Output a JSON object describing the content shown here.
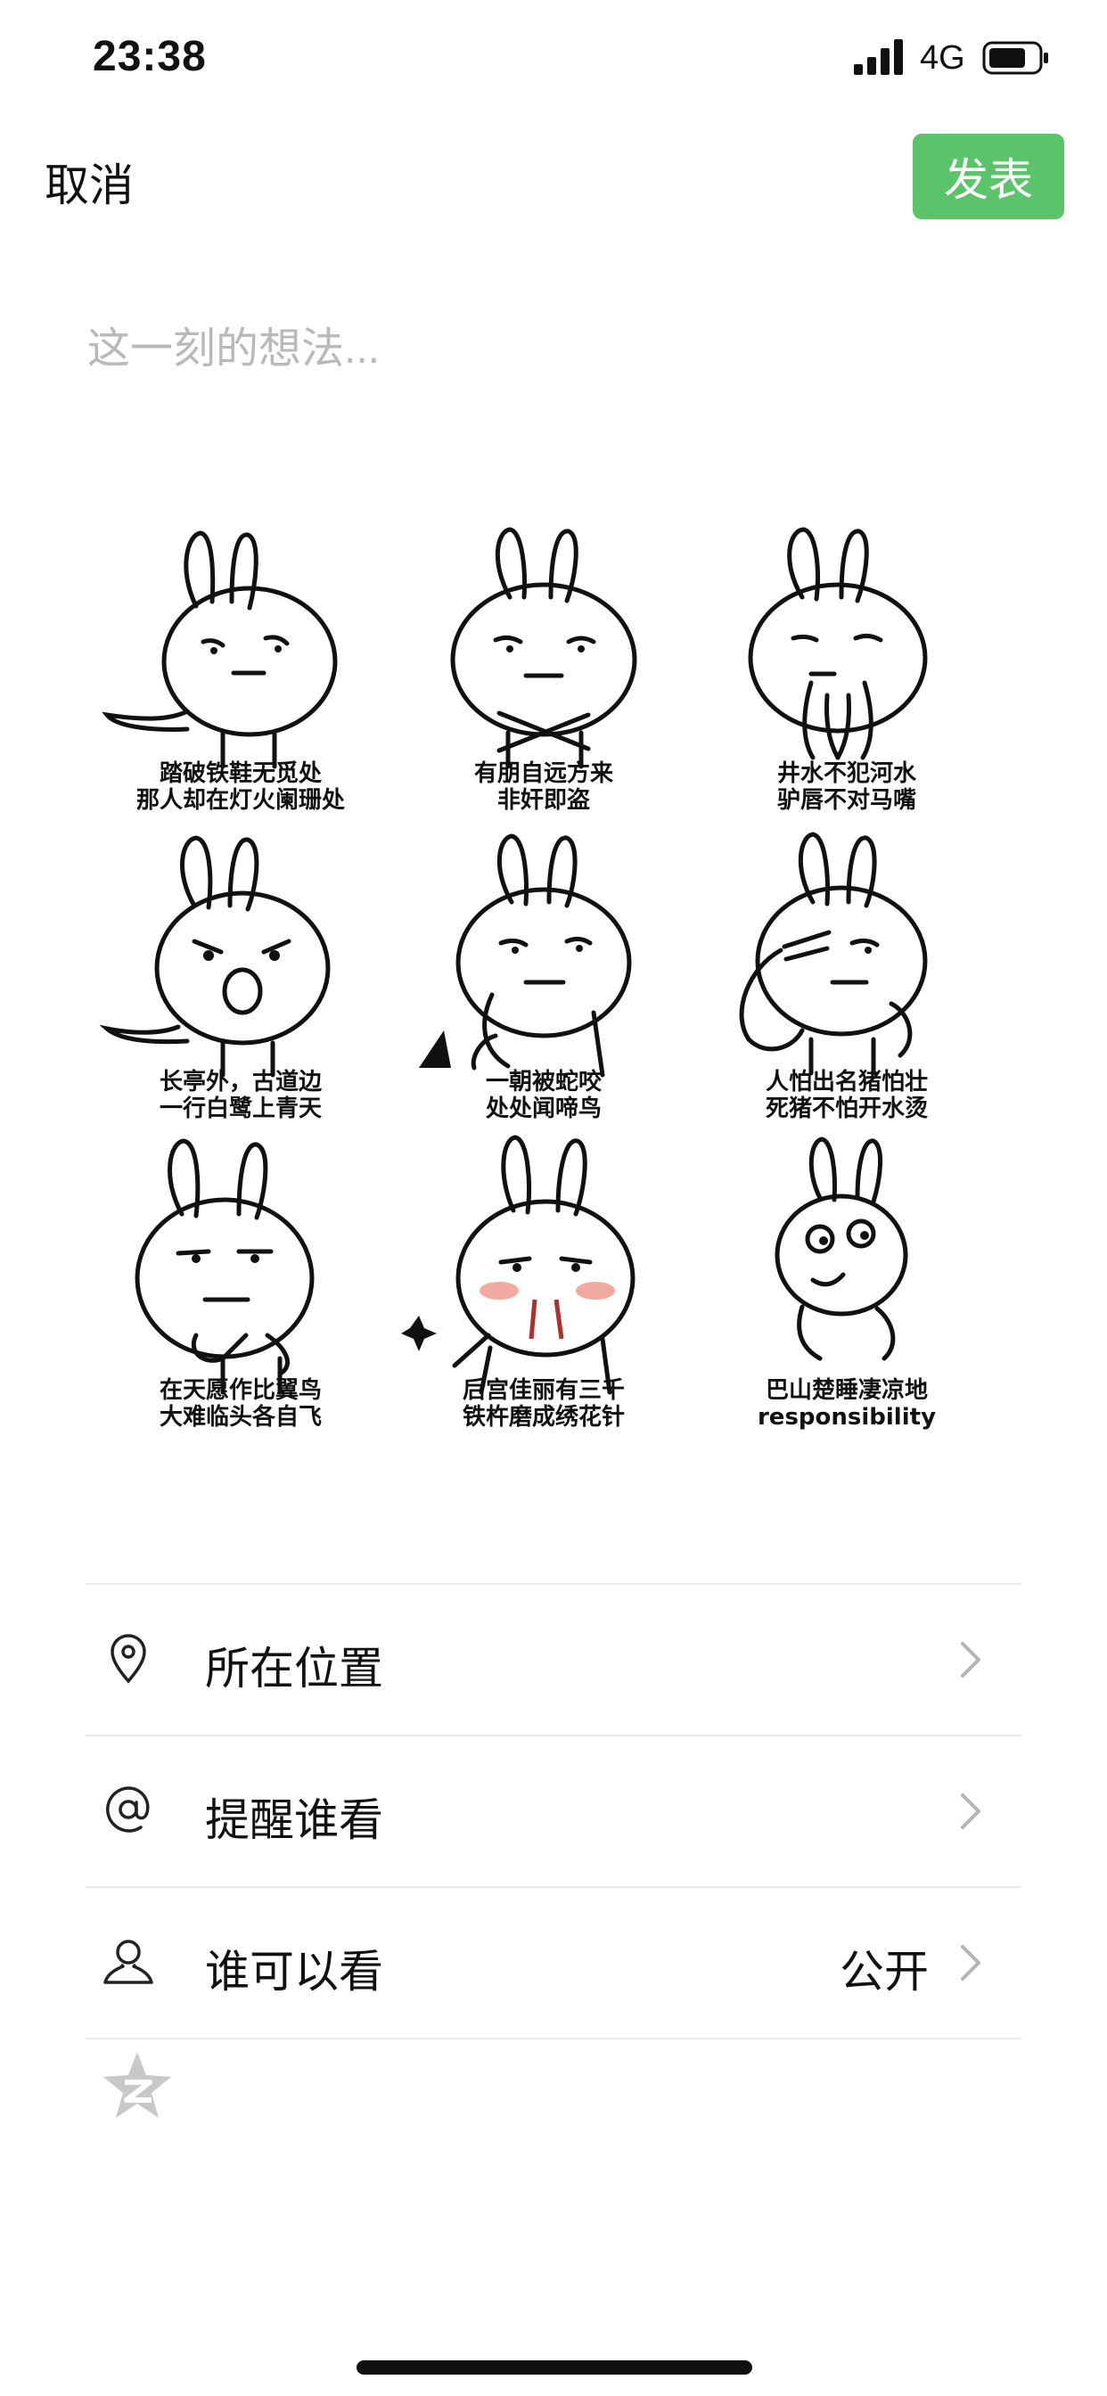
{
  "status_bar": {
    "time": "23:38",
    "network": "4G",
    "icons": [
      "signal-icon",
      "battery-icon"
    ]
  },
  "nav": {
    "cancel_label": "取消",
    "publish_label": "发表"
  },
  "compose": {
    "placeholder": "这一刻的想法..."
  },
  "images": [
    {
      "line1": "踏破铁鞋无觅处",
      "line2": "那人却在灯火阑珊处"
    },
    {
      "line1": "有朋自远方来",
      "line2": "非奸即盗"
    },
    {
      "line1": "井水不犯河水",
      "line2": "驴唇不对马嘴"
    },
    {
      "line1": "长亭外，古道边",
      "line2": "一行白鹭上青天"
    },
    {
      "line1": "一朝被蛇咬",
      "line2": "处处闻啼鸟"
    },
    {
      "line1": "人怕出名猪怕壮",
      "line2": "死猪不怕开水烫"
    },
    {
      "line1": "在天愿作比翼鸟",
      "line2": "大难临头各自飞"
    },
    {
      "line1": "后宫佳丽有三千",
      "line2": "铁杵磨成绣花针"
    },
    {
      "line1": "巴山楚睡凄凉地",
      "line2": "responsibility"
    }
  ],
  "options": {
    "location": {
      "label": "所在位置",
      "icon": "location-pin-icon"
    },
    "mention": {
      "label": "提醒谁看",
      "icon": "at-sign-icon"
    },
    "visibility": {
      "label": "谁可以看",
      "value": "公开",
      "icon": "person-icon"
    }
  },
  "colors": {
    "publish_green": "#5bc46a",
    "placeholder_gray": "#b9b9b9",
    "divider": "#ececec"
  }
}
